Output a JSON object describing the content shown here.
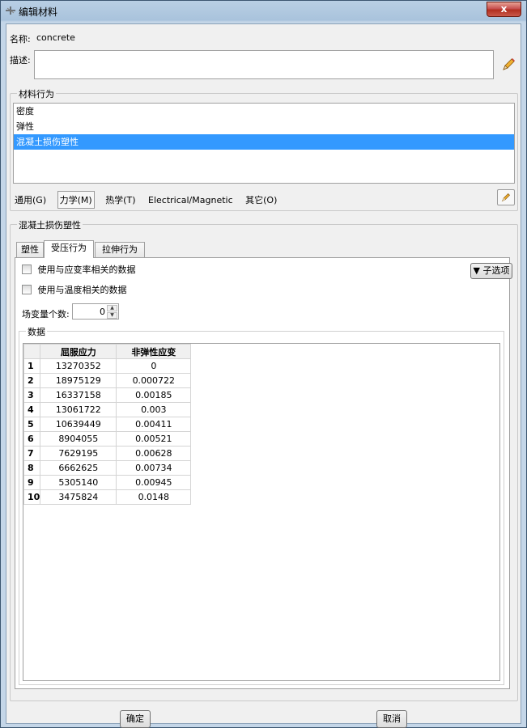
{
  "window": {
    "title": "编辑材料",
    "close_label": "x"
  },
  "name": {
    "label": "名称:",
    "value": "concrete"
  },
  "description": {
    "label": "描述:",
    "value": ""
  },
  "behaviors": {
    "group_title": "材料行为",
    "items": [
      "密度",
      "弹性",
      "混凝土损伤塑性"
    ],
    "selected_index": 2
  },
  "menu": {
    "items": [
      "通用(G)",
      "力学(M)",
      "热学(T)",
      "Electrical/Magnetic",
      "其它(O)"
    ],
    "pressed_index": 1
  },
  "cdp": {
    "group_title": "混凝土损伤塑性",
    "tabs": [
      "塑性",
      "受压行为",
      "拉伸行为"
    ],
    "active_tab": 1,
    "check_strain_rate": "使用与应变率相关的数据",
    "check_temperature": "使用与温度相关的数据",
    "suboptions_label": "子选项",
    "field_vars_label": "场变量个数:",
    "field_vars_value": "0",
    "data_title": "数据",
    "columns": [
      "屈服应力",
      "非弹性应变"
    ],
    "rows": [
      [
        "1",
        "13270352",
        "0"
      ],
      [
        "2",
        "18975129",
        "0.000722"
      ],
      [
        "3",
        "16337158",
        "0.00185"
      ],
      [
        "4",
        "13061722",
        "0.003"
      ],
      [
        "5",
        "10639449",
        "0.00411"
      ],
      [
        "6",
        "8904055",
        "0.00521"
      ],
      [
        "7",
        "7629195",
        "0.00628"
      ],
      [
        "8",
        "6662625",
        "0.00734"
      ],
      [
        "9",
        "5305140",
        "0.00945"
      ],
      [
        "10",
        "3475824",
        "0.0148"
      ]
    ]
  },
  "buttons": {
    "ok": "确定",
    "cancel": "取消"
  },
  "colors": {
    "selection": "#3399ff",
    "close": "#c75050"
  }
}
